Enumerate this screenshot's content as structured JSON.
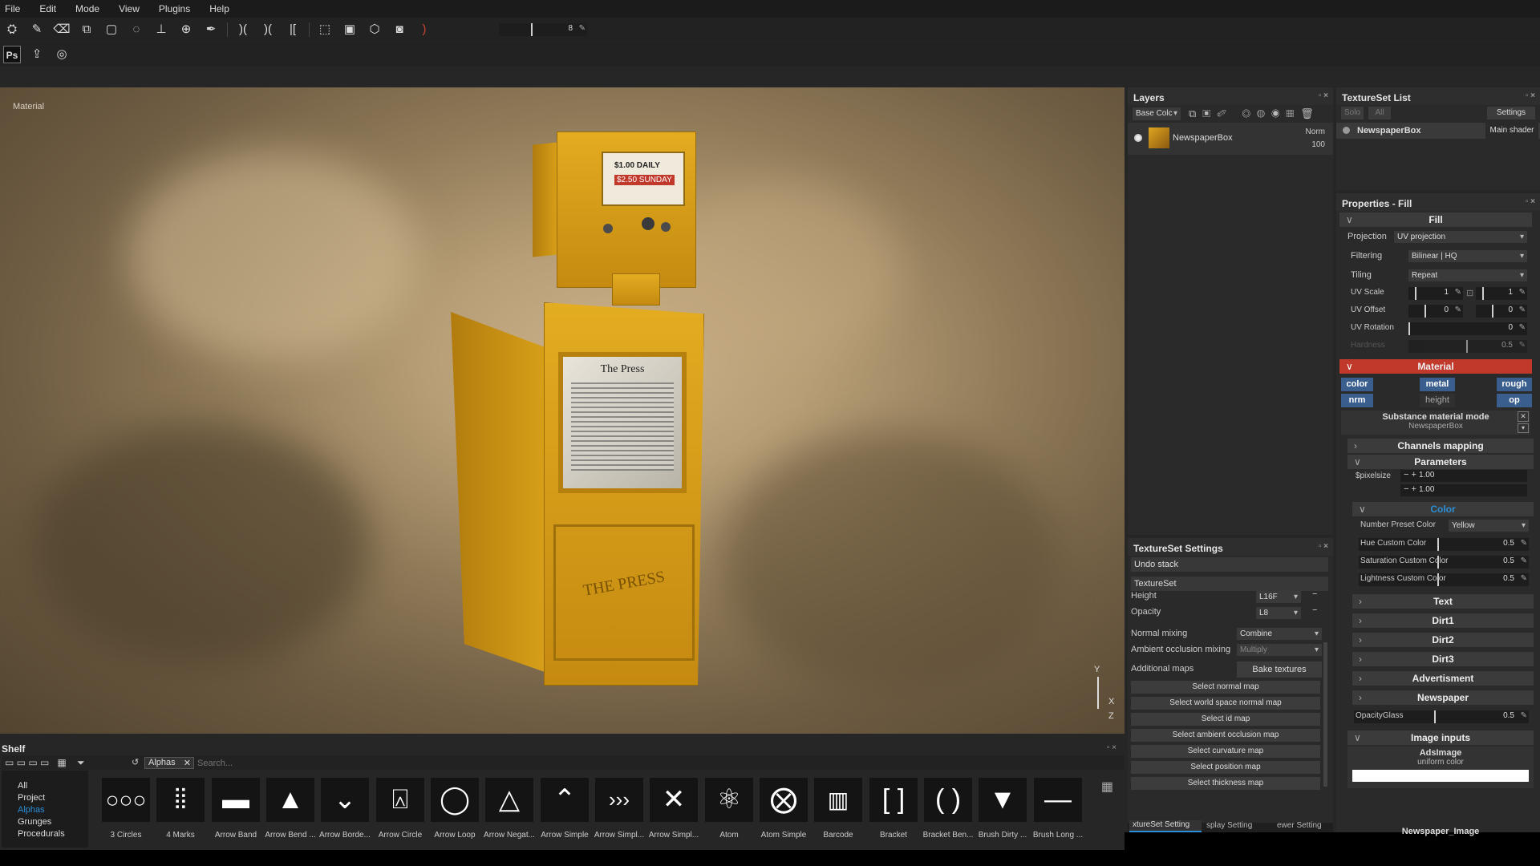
{
  "menu": [
    "File",
    "Edit",
    "Mode",
    "View",
    "Plugins",
    "Help"
  ],
  "toolbar": {
    "brush_size": "8"
  },
  "viewport": {
    "label": "Material",
    "price_top": "$1.00 DAILY",
    "price_bottom": "$2.50 SUNDAY",
    "paper_title": "The Press",
    "box_text": "THE PRESS",
    "axis_y": "Y",
    "axis_x": "X",
    "axis_z": "Z"
  },
  "layers": {
    "title": "Layers",
    "channel": "Base Colc",
    "items": [
      {
        "name": "NewspaperBox",
        "blend": "Norm",
        "opacity": "100"
      }
    ]
  },
  "texture_set_list": {
    "title": "TextureSet List",
    "solo": "Solo",
    "all": "All",
    "settings": "Settings",
    "item": "NewspaperBox",
    "shader": "Main shader"
  },
  "properties": {
    "title": "Properties - Fill",
    "fill": "Fill",
    "projection_label": "Projection",
    "projection": "UV projection",
    "filtering_label": "Filtering",
    "filtering": "Bilinear | HQ",
    "tiling_label": "Tiling",
    "tiling": "Repeat",
    "uv_scale_label": "UV Scale",
    "uv_scale_a": "1",
    "uv_scale_b": "1",
    "uv_offset_label": "UV Offset",
    "uv_offset_a": "0",
    "uv_offset_b": "0",
    "uv_rotation_label": "UV Rotation",
    "uv_rotation": "0",
    "hardness_label": "Hardness",
    "hardness": "0.5",
    "material": "Material",
    "channels": [
      "color",
      "metal",
      "rough",
      "nrm",
      "height",
      "op"
    ],
    "substance_mode": "Substance material mode",
    "substance_name": "NewspaperBox",
    "channels_mapping": "Channels mapping",
    "parameters": "Parameters",
    "pixelsize_label": "$pixelsize",
    "pixelsize_a": "1.00",
    "pixelsize_b": "1.00",
    "color": "Color",
    "preset_label": "Number Preset Color",
    "preset": "Yellow",
    "hue_label": "Hue Custom Color",
    "hue": "0.5",
    "saturation_label": "Saturation Custom Color",
    "saturation": "0.5",
    "lightness_label": "Lightness Custom Color",
    "lightness": "0.5",
    "groups": [
      "Text",
      "Dirt1",
      "Dirt2",
      "Dirt3",
      "Advertisment",
      "Newspaper"
    ],
    "opacity_glass_label": "OpacityGlass",
    "opacity_glass": "0.5",
    "image_inputs": "Image inputs",
    "ads_image": "AdsImage",
    "uniform_color": "uniform color",
    "newspaper_image": "Newspaper_Image"
  },
  "texset_settings": {
    "title": "TextureSet Settings",
    "undo_stack": "Undo stack",
    "textureset": "TextureSet",
    "height_label": "Height",
    "height": "L16F",
    "opacity_label": "Opacity",
    "opacity": "L8",
    "normal_mixing_label": "Normal mixing",
    "normal_mixing": "Combine",
    "ao_mixing_label": "Ambient occlusion mixing",
    "ao_mixing": "Multiply",
    "additional_maps_label": "Additional maps",
    "bake": "Bake textures",
    "maps": [
      "Select normal map",
      "Select world space normal map",
      "Select id map",
      "Select ambient occlusion map",
      "Select curvature map",
      "Select position map",
      "Select thickness map"
    ],
    "tabs": [
      "xtureSet Setting",
      "splay Setting",
      "ewer Setting"
    ]
  },
  "shelf": {
    "title": "Shelf",
    "filter": "Alphas",
    "search_placeholder": "Search...",
    "categories": [
      "All",
      "Project",
      "Alphas",
      "Grunges",
      "Procedurals"
    ],
    "items": [
      "3 Circles",
      "4 Marks",
      "Arrow Band",
      "Arrow Bend ...",
      "Arrow Borde...",
      "Arrow Circle",
      "Arrow Loop",
      "Arrow Negat...",
      "Arrow Simple",
      "Arrow Simpl...",
      "Arrow Simpl...",
      "Atom",
      "Atom Simple",
      "Barcode",
      "Bracket",
      "Bracket Ben...",
      "Brush Dirty ...",
      "Brush Long ..."
    ]
  },
  "colors": {
    "accent": "#2a8fd6",
    "material_header": "#c0392b",
    "box_yellow": "#d9a11a"
  }
}
